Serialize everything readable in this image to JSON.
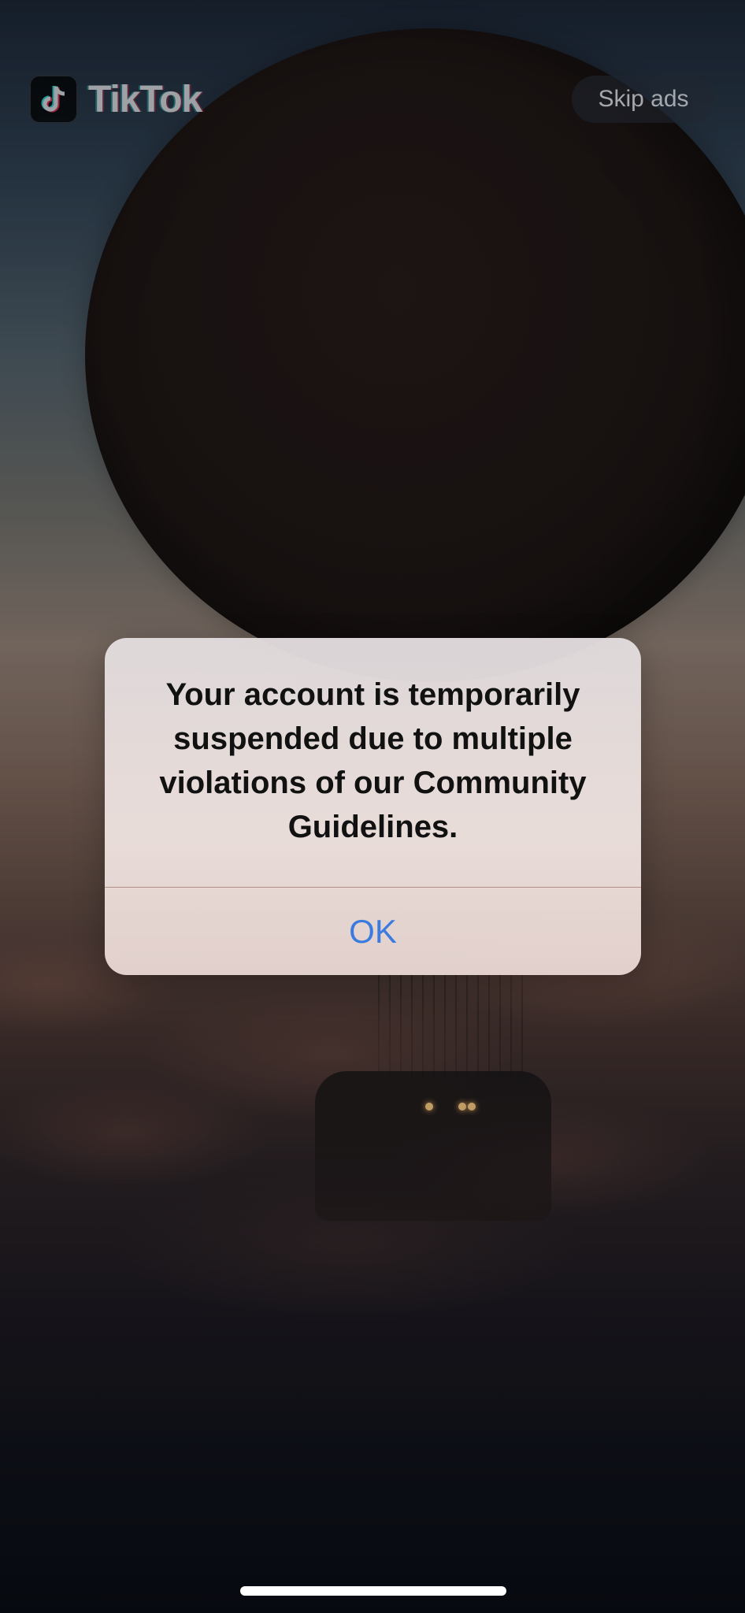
{
  "brand": {
    "name": "TikTok",
    "icon": "tiktok-note-icon",
    "colors": {
      "cyan": "#25F4EE",
      "red": "#FE2C55"
    }
  },
  "ad": {
    "skip_label": "Skip ads"
  },
  "alert": {
    "message": "Your account is temporarily suspended due to multiple violations of our Community Guidelines.",
    "ok_label": "OK",
    "accent_color": "#3B7BE0"
  }
}
